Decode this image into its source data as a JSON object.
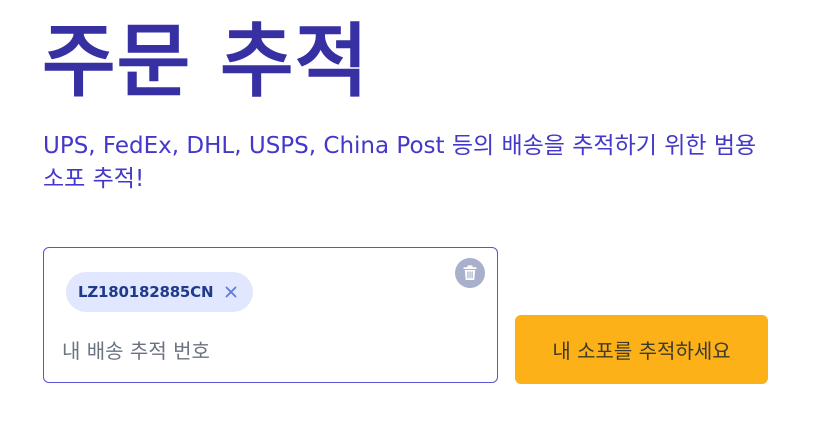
{
  "header": {
    "title": "주문 추적",
    "subtitle": "UPS, FedEx, DHL, USPS, China Post 등의 배송을 추적하기 위한 범용 소포 추적!"
  },
  "tracking_form": {
    "chips": [
      {
        "label": "LZ180182885CN",
        "remove_icon": "close-icon"
      }
    ],
    "clear_icon": "trash-icon",
    "input_value": "",
    "input_placeholder": "내 배송 추적 번호",
    "submit_label": "내 소포를 추적하세요"
  },
  "colors": {
    "title": "#3730a3",
    "subtitle": "#4338ca",
    "input_border": "#5b52d6",
    "chip_background": "#e0e7ff",
    "chip_text": "#1e3a8a",
    "clear_button": "#a8b0cc",
    "button_background": "#fbb117",
    "button_text": "#3f3a2a"
  }
}
